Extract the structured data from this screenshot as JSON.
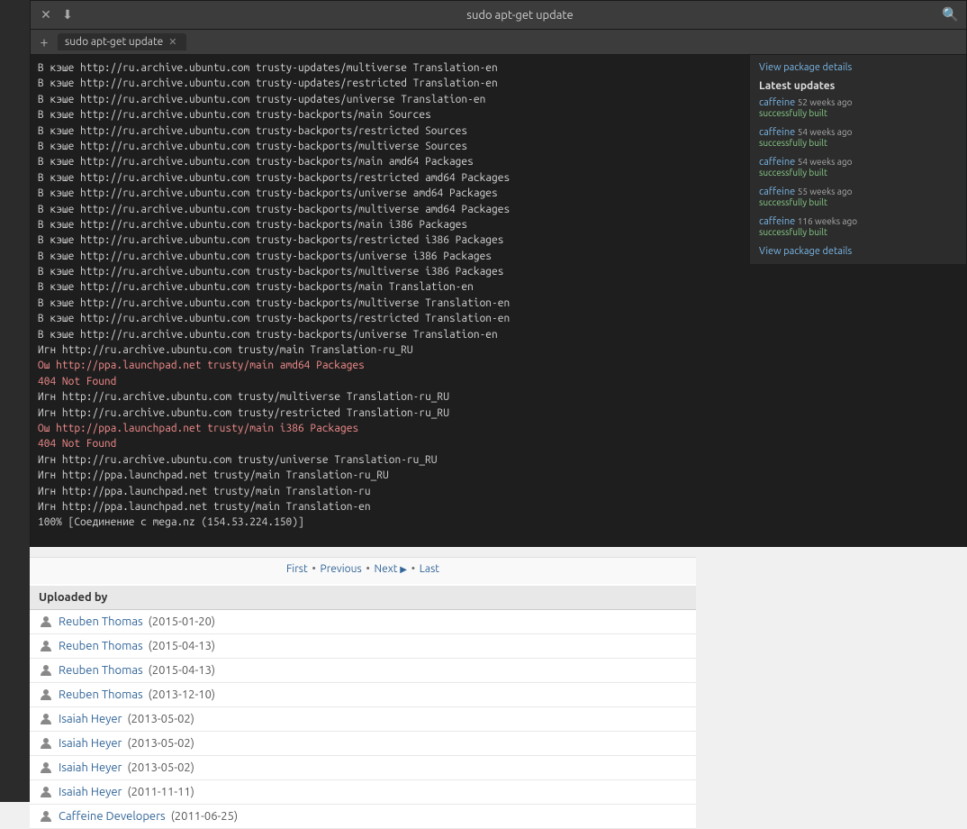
{
  "terminal": {
    "title": "sudo apt-get update",
    "tab_label": "sudo apt-get update",
    "close_icon": "✕",
    "download_icon": "⬇",
    "new_tab_icon": "+",
    "search_icon": "🔍",
    "lines": [
      "В кэше http://ru.archive.ubuntu.com  trusty-updates/multiverse Translation-en",
      "В кэше http://ru.archive.ubuntu.com  trusty-updates/restricted Translation-en",
      "В кэше http://ru.archive.ubuntu.com  trusty-updates/universe Translation-en",
      "В кэше http://ru.archive.ubuntu.com  trusty-backports/main Sources",
      "В кэше http://ru.archive.ubuntu.com  trusty-backports/restricted Sources",
      "В кэше http://ru.archive.ubuntu.com  trusty-backports/multiverse Sources",
      "В кэше http://ru.archive.ubuntu.com  trusty-backports/main amd64 Packages",
      "В кэше http://ru.archive.ubuntu.com  trusty-backports/restricted amd64 Packages",
      "В кэше http://ru.archive.ubuntu.com  trusty-backports/universe amd64 Packages",
      "В кэше http://ru.archive.ubuntu.com  trusty-backports/multiverse amd64 Packages",
      "В кэше http://ru.archive.ubuntu.com  trusty-backports/main i386 Packages",
      "В кэше http://ru.archive.ubuntu.com  trusty-backports/restricted i386 Packages",
      "В кэше http://ru.archive.ubuntu.com  trusty-backports/universe i386 Packages",
      "В кэше http://ru.archive.ubuntu.com  trusty-backports/multiverse i386 Packages",
      "В кэше http://ru.archive.ubuntu.com  trusty-backports/main Translation-en",
      "В кэше http://ru.archive.ubuntu.com  trusty-backports/multiverse Translation-en",
      "В кэше http://ru.archive.ubuntu.com  trusty-backports/restricted Translation-en",
      "В кэше http://ru.archive.ubuntu.com  trusty-backports/universe Translation-en",
      "Игн http://ru.archive.ubuntu.com  trusty/main Translation-ru_RU",
      "Ош  http://ppa.launchpad.net  trusty/main amd64 Packages",
      "    404  Not Found",
      "Игн http://ru.archive.ubuntu.com  trusty/multiverse Translation-ru_RU",
      "Игн http://ru.archive.ubuntu.com  trusty/restricted Translation-ru_RU",
      "Ош  http://ppa.launchpad.net  trusty/main i386 Packages",
      "    404  Not Found",
      "Игн http://ru.archive.ubuntu.com  trusty/universe Translation-ru_RU",
      "Игн http://ppa.launchpad.net  trusty/main Translation-ru_RU",
      "Игн http://ppa.launchpad.net  trusty/main Translation-ru",
      "Игн http://ppa.launchpad.net  trusty/main Translation-en",
      "100% [Соединение с mega.nz (154.53.224.150)]"
    ],
    "sidebar": {
      "view_package_details_link": "View package details",
      "latest_updates_title": "Latest updates",
      "updates": [
        {
          "name": "caffeine",
          "time": "52 weeks ago",
          "status": "successfully built"
        },
        {
          "name": "caffeine",
          "time": "54 weeks ago",
          "status": "successfully built"
        },
        {
          "name": "caffeine",
          "time": "54 weeks ago",
          "status": "successfully built"
        },
        {
          "name": "caffeine",
          "time": "55 weeks ago",
          "status": "successfully built"
        },
        {
          "name": "caffeine",
          "time": "116 weeks ago",
          "status": "successfully built"
        }
      ],
      "view_package_details_link2": "View package details"
    }
  },
  "pagination": {
    "first": "First",
    "previous": "Previous",
    "next": "Next",
    "last": "Last",
    "sep": "•"
  },
  "uploaded_by": {
    "header": "Uploaded by",
    "rows": [
      {
        "user": "Reuben Thomas",
        "date": "(2015-01-20)"
      },
      {
        "user": "Reuben Thomas",
        "date": "(2015-04-13)"
      },
      {
        "user": "Reuben Thomas",
        "date": "(2015-04-13)"
      },
      {
        "user": "Reuben Thomas",
        "date": "(2013-12-10)"
      },
      {
        "user": "Isaiah Heyer",
        "date": "(2013-05-02)"
      },
      {
        "user": "Isaiah Heyer",
        "date": "(2013-05-02)"
      },
      {
        "user": "Isaiah Heyer",
        "date": "(2013-05-02)"
      },
      {
        "user": "Isaiah Heyer",
        "date": "(2011-11-11)"
      },
      {
        "user": "Caffeine Developers",
        "date": "(2011-06-25)"
      }
    ]
  }
}
